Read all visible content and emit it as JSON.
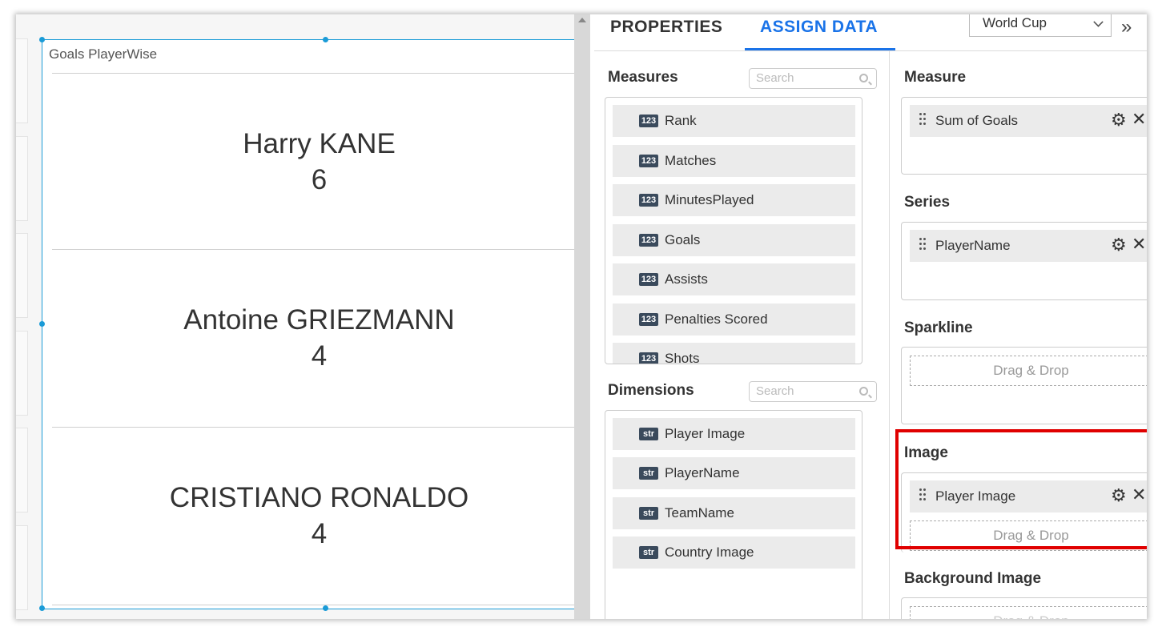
{
  "canvas": {
    "widget_title": "Goals PlayerWise",
    "cards": [
      {
        "name": "Harry KANE",
        "value": "6"
      },
      {
        "name": "Antoine GRIEZMANN",
        "value": "4"
      },
      {
        "name": "CRISTIANO RONALDO",
        "value": "4"
      }
    ]
  },
  "panel": {
    "tabs": [
      {
        "label": "PROPERTIES"
      },
      {
        "label": "ASSIGN DATA"
      }
    ],
    "active_tab": "ASSIGN DATA",
    "datasource": "World Cup",
    "collapse_glyph": "»",
    "measures": {
      "title": "Measures",
      "search_placeholder": "Search",
      "badge": "123",
      "items": [
        "Rank",
        "Matches",
        "MinutesPlayed",
        "Goals",
        "Assists",
        "Penalties Scored",
        "Shots"
      ]
    },
    "dimensions": {
      "title": "Dimensions",
      "search_placeholder": "Search",
      "badge": "str",
      "items": [
        "Player Image",
        "PlayerName",
        "TeamName",
        "Country Image"
      ]
    },
    "wells": {
      "measure": {
        "title": "Measure",
        "chip": "Sum of Goals"
      },
      "series": {
        "title": "Series",
        "chip": "PlayerName"
      },
      "sparkline": {
        "title": "Sparkline",
        "drop": "Drag & Drop"
      },
      "image": {
        "title": "Image",
        "chip": "Player Image",
        "drop": "Drag & Drop"
      },
      "background_image": {
        "title": "Background Image",
        "drop": "Drag & Drop"
      }
    }
  },
  "colors": {
    "accent": "#1a73e8",
    "selection": "#1a9bd7",
    "highlight": "#e00000"
  }
}
